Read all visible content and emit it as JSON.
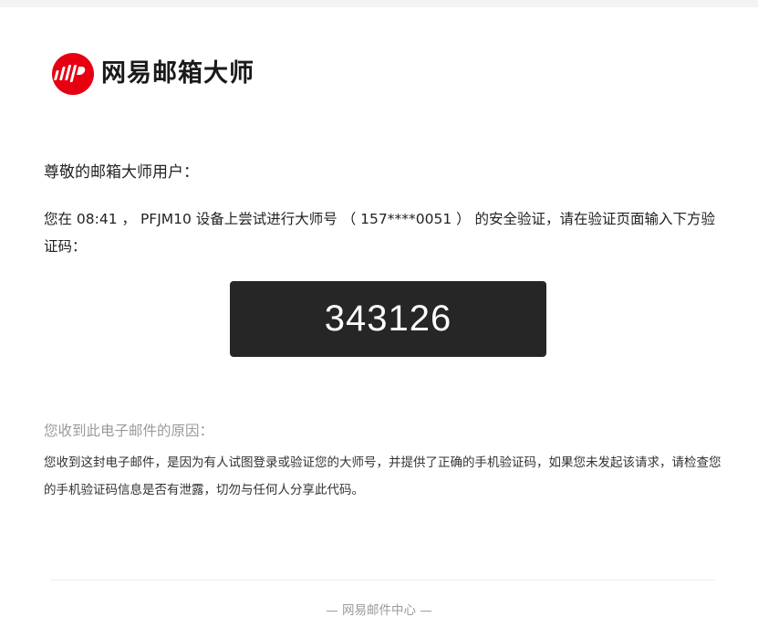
{
  "brand": {
    "name": "网易邮箱大师",
    "logo_icon": "netease-mail-master-logo-icon",
    "accent_color": "#e60012"
  },
  "email": {
    "greeting": "尊敬的邮箱大师用户：",
    "message": "您在 08:41 ， PFJM10 设备上尝试进行大师号 （ 157****0051 ） 的安全验证，请在验证页面输入下方验证码：",
    "verification_code": "343126",
    "reason_title": "您收到此电子邮件的原因：",
    "reason_body": "您收到这封电子邮件，是因为有人试图登录或验证您的大师号，并提供了正确的手机验证码，如果您未发起该请求，请检查您的手机验证码信息是否有泄露，切勿与任何人分享此代码。",
    "footer": "— 网易邮件中心 —"
  },
  "colors": {
    "code_box_bg": "#262626",
    "muted_text": "#9a9a9a"
  }
}
